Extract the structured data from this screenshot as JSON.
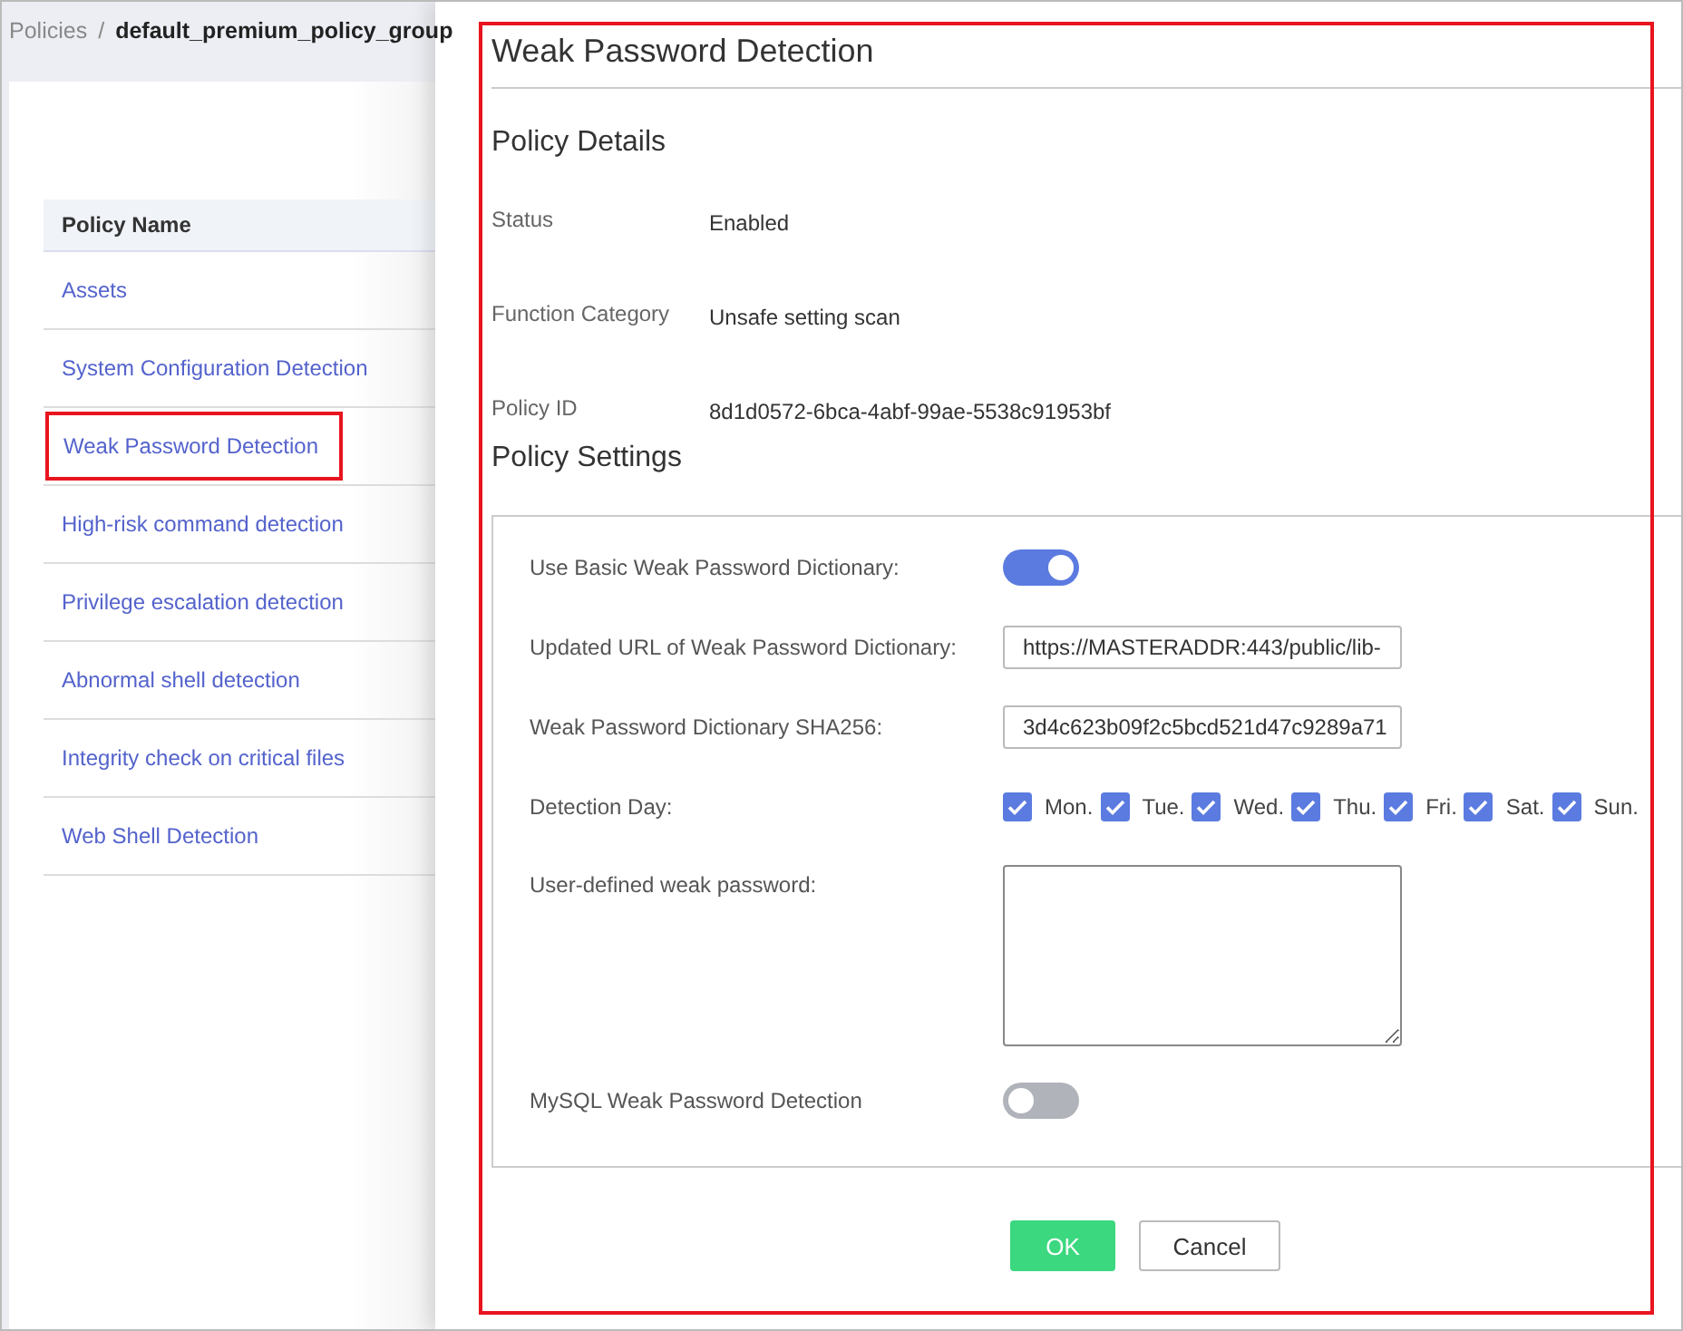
{
  "breadcrumb": [
    {
      "label": "Policies"
    },
    {
      "label": "default_premium_policy_group"
    }
  ],
  "breadcrumb_separator": "/",
  "policy_table": {
    "column": "Policy Name",
    "rows": [
      {
        "label": "Assets",
        "selected": false
      },
      {
        "label": "System Configuration Detection",
        "selected": false
      },
      {
        "label": "Weak Password Detection",
        "selected": true
      },
      {
        "label": "High-risk command detection",
        "selected": false
      },
      {
        "label": "Privilege escalation detection",
        "selected": false
      },
      {
        "label": "Abnormal shell detection",
        "selected": false
      },
      {
        "label": "Integrity check on critical files",
        "selected": false
      },
      {
        "label": "Web Shell Detection",
        "selected": false
      }
    ]
  },
  "drawer": {
    "title": "Weak Password Detection",
    "details_heading": "Policy Details",
    "details": [
      {
        "label": "Status",
        "value": "Enabled"
      },
      {
        "label": "Function Category",
        "value": "Unsafe setting scan"
      },
      {
        "label": "Policy ID",
        "value": "8d1d0572-6bca-4abf-99ae-5538c91953bf"
      }
    ],
    "settings_heading": "Policy Settings",
    "settings": [
      {
        "kind": "toggle",
        "label": "Use Basic Weak Password Dictionary:",
        "on": true
      },
      {
        "kind": "text",
        "label": "Updated URL of Weak Password Dictionary:",
        "value": "https://MASTERADDR:443/public/lib-"
      },
      {
        "kind": "text",
        "label": "Weak Password Dictionary SHA256:",
        "value": "3d4c623b09f2c5bcd521d47c9289a71"
      },
      {
        "kind": "days",
        "label": "Detection Day:",
        "days": [
          {
            "label": "Mon.",
            "checked": true
          },
          {
            "label": "Tue.",
            "checked": true
          },
          {
            "label": "Wed.",
            "checked": true
          },
          {
            "label": "Thu.",
            "checked": true
          },
          {
            "label": "Fri.",
            "checked": true
          },
          {
            "label": "Sat.",
            "checked": true
          },
          {
            "label": "Sun.",
            "checked": true
          }
        ]
      },
      {
        "kind": "textarea",
        "label": "User-defined weak password:"
      },
      {
        "kind": "toggle",
        "label": "MySQL Weak Password Detection",
        "on": false
      }
    ],
    "buttons": [
      {
        "kind": "primary",
        "label": "OK"
      },
      {
        "kind": "default",
        "label": "Cancel"
      }
    ]
  }
}
